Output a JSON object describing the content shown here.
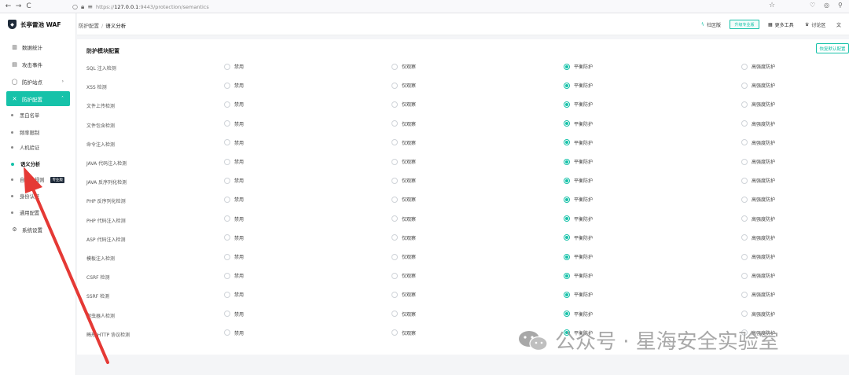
{
  "browser": {
    "back": "←",
    "forward": "→",
    "reload": "C",
    "url_prefix": "https://",
    "url_host": "127.0.0.1",
    "url_path": ":9443/protection/semantics"
  },
  "app": {
    "name": "长亭雷池 WAF"
  },
  "sidebar": {
    "items": [
      {
        "label": "数据统计",
        "icon": "bar-chart-icon"
      },
      {
        "label": "攻击事件",
        "icon": "event-log-icon"
      },
      {
        "label": "防护站点",
        "icon": "shield-outline-icon"
      },
      {
        "label": "防护配置",
        "icon": "tools-icon"
      },
      {
        "label": "系统设置",
        "icon": "gear-icon"
      }
    ],
    "sub_items": [
      {
        "label": "黑白名单"
      },
      {
        "label": "频率限制"
      },
      {
        "label": "人机验证"
      },
      {
        "label": "语义分析"
      },
      {
        "label": "自定义规则",
        "badge": "专业版"
      },
      {
        "label": "身份认证"
      },
      {
        "label": "通用配置"
      }
    ]
  },
  "header": {
    "breadcrumb_parent": "防护配置",
    "breadcrumb_sep": "/",
    "breadcrumb_current": "语义分析",
    "edition": "社区版",
    "upgrade": "升级专业版",
    "more_tools": "更多工具",
    "forum": "讨论区"
  },
  "card": {
    "title": "防护模块配置",
    "restore_button": "恢复默认配置",
    "options": [
      "禁用",
      "仅观察",
      "平衡防护",
      "高强度防护"
    ],
    "selected_option": "平衡防护",
    "rows": [
      {
        "label": "SQL 注入检测"
      },
      {
        "label": "XSS 检测"
      },
      {
        "label": "文件上传检测"
      },
      {
        "label": "文件包含检测"
      },
      {
        "label": "命令注入检测"
      },
      {
        "label": "JAVA 代码注入检测"
      },
      {
        "label": "JAVA 反序列化检测"
      },
      {
        "label": "PHP 反序列化检测"
      },
      {
        "label": "PHP 代码注入检测"
      },
      {
        "label": "ASP 代码注入检测"
      },
      {
        "label": "模板注入检测"
      },
      {
        "label": "CSRF 检测"
      },
      {
        "label": "SSRF 检测"
      },
      {
        "label": "爬虫器人检测"
      },
      {
        "label": "畸形 HTTP 协议检测"
      }
    ]
  },
  "watermark": {
    "text": "公众号 · 星海安全实验室"
  },
  "colors": {
    "accent": "#16c2a9",
    "arrow": "#e53935",
    "sidebar_dark": "#1f2b3a"
  }
}
